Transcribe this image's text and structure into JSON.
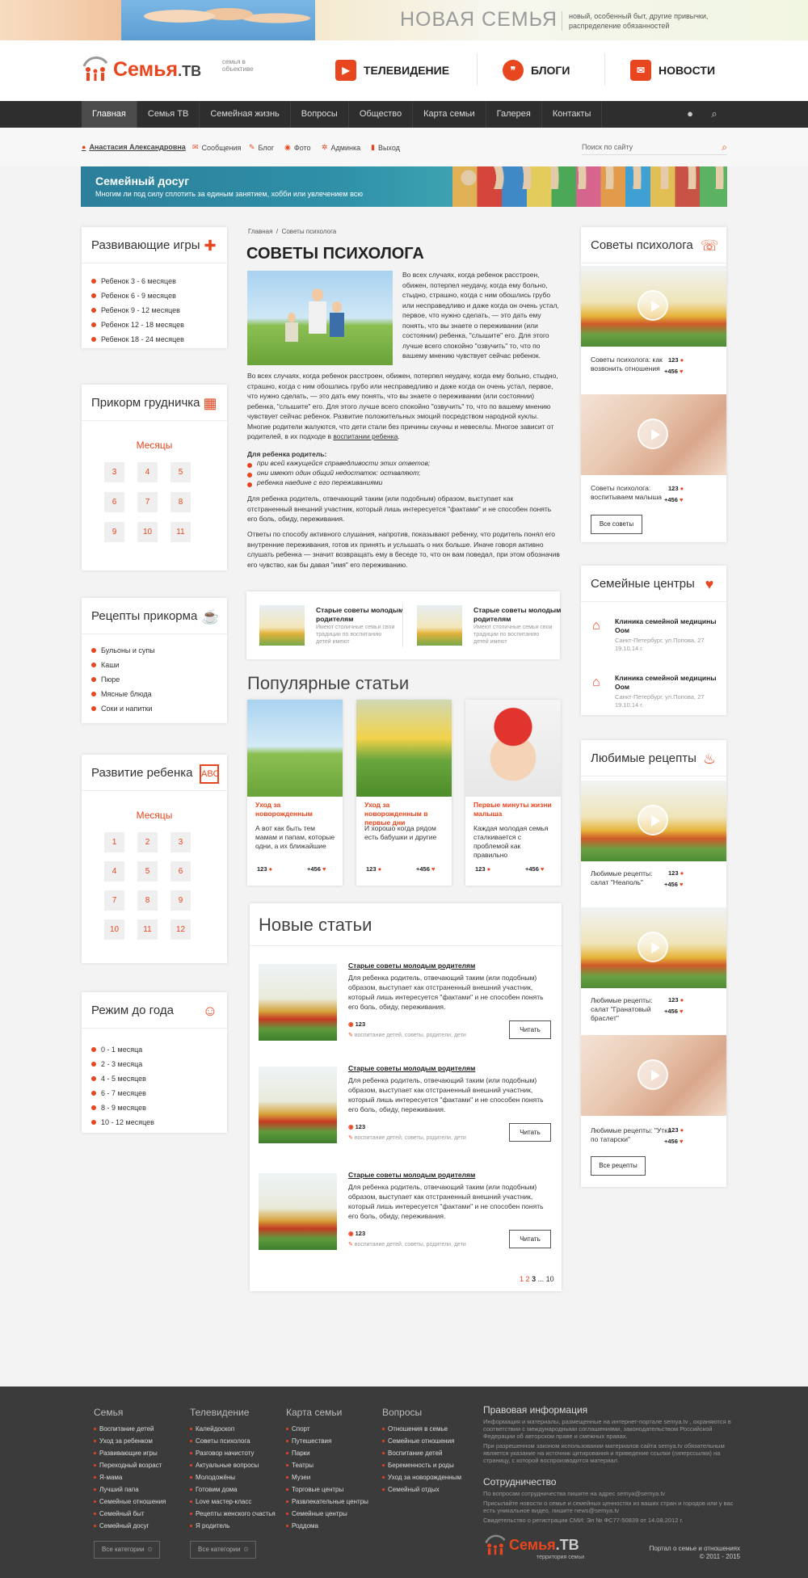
{
  "topbanner": {
    "slogan": "НОВАЯ СЕМЬЯ",
    "subtitle": "новый, особенный быт, другие привычки, распределение обязанностей"
  },
  "logo": {
    "name": "Семья",
    "suffix": ".ТВ",
    "tagline": "семья в объективе"
  },
  "header_nav": [
    {
      "label": "ТЕЛЕВИДЕНИЕ",
      "icon": "play-icon"
    },
    {
      "label": "БЛОГИ",
      "icon": "quote-icon"
    },
    {
      "label": "НОВОСТИ",
      "icon": "megaphone-icon"
    }
  ],
  "main_nav": [
    "Главная",
    "Семья ТВ",
    "Семейная жизнь",
    "Вопросы",
    "Общество",
    "Карта семьи",
    "Галерея",
    "Контакты"
  ],
  "user_bar": {
    "user": "Анастасия Александровна",
    "links": [
      "Сообщения",
      "Блог",
      "Фото",
      "Админка",
      "Выход"
    ],
    "search_placeholder": "Поиск по сайту"
  },
  "promo": {
    "title": "Семейный досуг",
    "text": "Многим ли под силу сплотить за единым занятием, хобби или увлечением всю"
  },
  "left": {
    "games": {
      "title": "Развивающие игры",
      "items": [
        "Ребенок 3 - 6 месяцев",
        "Ребенок 6 - 9 месяцев",
        "Ребенок 9 - 12 месяцев",
        "Ребенок 12 - 18 месяцев",
        "Ребенок 18 - 24 месяцев"
      ]
    },
    "feeding": {
      "title": "Прикорм грудничка",
      "months_label": "Месяцы",
      "months": [
        "3",
        "4",
        "5",
        "6",
        "7",
        "8",
        "9",
        "10",
        "11"
      ]
    },
    "recipes": {
      "title": "Рецепты прикорма",
      "items": [
        "Бульоны и супы",
        "Каши",
        "Пюре",
        "Мясные блюда",
        "Соки и напитки"
      ]
    },
    "development": {
      "title": "Развитие ребенка",
      "months_label": "Месяцы",
      "months": [
        "1",
        "2",
        "3",
        "4",
        "5",
        "6",
        "7",
        "8",
        "9",
        "10",
        "11",
        "12"
      ]
    },
    "regime": {
      "title": "Режим до года",
      "items": [
        "0 - 1 месяца",
        "2 - 3 месяца",
        "4 - 5 месяцев",
        "6 - 7 месяцев",
        "8 - 9 месяцев",
        "10 - 12 месяцев"
      ]
    }
  },
  "article": {
    "breadcrumb": [
      "Главная",
      "Советы психолога"
    ],
    "title": "СОВЕТЫ ПСИХОЛОГА",
    "p1": "Во всех случаях, когда ребенок расстроен, обижен, потерпел неудачу, когда ему больно, стыдно, страшно, когда с ним обошлись грубо или несправедливо и даже когда он очень устал, первое, что нужно сделать, — это дать ему понять, что вы знаете о переживании (или состоянии) ребенка, \"слышите\" его. Для этого лучше всего спокойно \"озвучить\" то, что по вашему мнению чувствует сейчас ребенок.",
    "p2_a": "Во всех случаях, когда ребенок расстроен, обижен, потерпел неудачу, когда ему больно, стыдно, страшно, когда с ним обошлись грубо или несправедливо и даже когда он очень устал, первое, что нужно сделать, — это дать ему понять, что вы знаете о переживании (или состоянии) ребенка, \"слышите\" его. Для этого лучше всего спокойно \"озвучить\" то, что по вашему мнению чувствует сейчас ребенок. Развитие положительных эмоций посредством народной куклы. Многие родители жалуются, что дети стали без причины скучны и невеселы. Многое зависит от родителей, в их подходе в ",
    "p2_link": "воспитании ребенка",
    "list_title": "Для  ребенка родитель:",
    "list": [
      "при всей кажущейся справедливости этих ответов;",
      "они имеют один общий недостаток: оставляют;",
      "ребенка наедине с его переживаниями"
    ],
    "p3": "Для ребенка родитель, отвечающий таким (или подобным) образом, выступает как отстраненный внешний участник, который лишь интересуется \"фактами\" и не способен понять его боль, обиду, переживания.",
    "p4": "Ответы по способу активного слушания, напротив, показывают ребенку, что родитель понял его внутренние переживания, готов их принять и услышать о них больше. Иначе говоря активно слушать ребенка — значит возвращать ему в беседе то, что он вам поведал, при этом обозначив его чувство, как бы давая \"имя\" его переживанию."
  },
  "related": [
    {
      "title": "Старые советы молодым родителям",
      "desc": "Имеют столичные семьи свои традиции по воспитанию детей имеют"
    },
    {
      "title": "Старые советы молодым родителям",
      "desc": "Имеют столичные семьи свои традиции по воспитанию детей имеют"
    }
  ],
  "popular": {
    "title": "Популярные статьи",
    "items": [
      {
        "title": "Уход за новорожденным",
        "desc": "А вот как быть тем мамам и папам, которые одни, а их ближайшие",
        "comments": "123",
        "likes": "+456"
      },
      {
        "title": "Уход за новорожденным в первые дни",
        "desc": "И хорошо когда рядом есть бабушки и другие",
        "comments": "123",
        "likes": "+456"
      },
      {
        "title": "Первые минуты жизни малыша",
        "desc": "Каждая молодая семья сталкивается с проблемой как правильно",
        "comments": "123",
        "likes": "+456"
      }
    ]
  },
  "new_articles": {
    "title": "Новые статьи",
    "items": [
      {
        "title": "Старые советы молодым родителям",
        "text": "Для ребенка родитель, отвечающий таким (или подобным) образом, выступает как отстраненный внешний участник, который лишь интересуется \"фактами\" и не способен понять его боль, обиду, переживания.",
        "views": "123",
        "tags": "воспитание детей, советы, родители, дети",
        "button": "Читать"
      },
      {
        "title": "Старые советы молодым родителям",
        "text": "Для ребенка родитель, отвечающий таким (или подобным) образом, выступает как отстраненный внешний участник, который лишь интересуется \"фактами\" и не способен понять его боль, обиду, переживания.",
        "views": "123",
        "tags": "воспитание детей, советы, родители, дети",
        "button": "Читать"
      },
      {
        "title": "Старые советы молодым родителям",
        "text": "Для ребенка родитель, отвечающий таким (или подобным) образом, выступает как отстраненный внешний участник, который лишь интересуется \"фактами\" и не способен понять его боль, обиду, переживания.",
        "views": "123",
        "tags": "воспитание детей, советы, родители, дети",
        "button": "Читать"
      }
    ],
    "pager": {
      "pages": [
        "1",
        "2",
        "3"
      ],
      "ellipsis": "...",
      "last": "10"
    }
  },
  "right": {
    "psych": {
      "title": "Советы психолога",
      "items": [
        {
          "caption": "Советы психолога: как возвонить отношения",
          "comments": "123",
          "likes": "+456"
        },
        {
          "caption": "Советы психолога: воспитываем малыша",
          "comments": "123",
          "likes": "+456"
        }
      ],
      "button": "Все советы"
    },
    "centers": {
      "title": "Семейные центры",
      "items": [
        {
          "name": "Клиника семейной медицины Оом",
          "address": "Санкт-Петербург, ул.Попова, 27 19.10.14 г."
        },
        {
          "name": "Клиника семейной медицины Оом",
          "address": "Санкт-Петербург, ул.Попова, 27 19.10.14 г."
        }
      ]
    },
    "recipes": {
      "title": "Любимые рецепты",
      "items": [
        {
          "caption": "Любимые рецепты: салат \"Неаполь\"",
          "comments": "123",
          "likes": "+456"
        },
        {
          "caption": "Любимые рецепты: салат \"Гранатовый браслет\"",
          "comments": "123",
          "likes": "+456"
        },
        {
          "caption": "Любимые рецепты: \"Утка по татарски\"",
          "comments": "123",
          "likes": "+456"
        }
      ],
      "button": "Все рецепты"
    }
  },
  "footer": {
    "cols": [
      {
        "title": "Семья",
        "items": [
          "Воспитание детей",
          "Уход за ребенком",
          "Развивающие игры",
          "Переходный возраст",
          "Я-мама",
          "Лучший папа",
          "Семейные отношения",
          "Семейный быт",
          "Семейный досуг"
        ],
        "button": "Все категории"
      },
      {
        "title": "Телевидение",
        "items": [
          "Калейдоскоп",
          "Советы психолога",
          "Разговор начистоту",
          "Актуальные вопросы",
          "Молодожёны",
          "Готовим дома",
          "Love мастер-класс",
          "Рецепты женского счастья",
          "Я родитель"
        ],
        "button": "Все категории"
      },
      {
        "title": "Карта семьи",
        "items": [
          "Спорт",
          "Путешествия",
          "Парки",
          "Театры",
          "Музеи",
          "Торговые центры",
          "Развлекательные центры",
          "Семейные центры",
          "Роддома"
        ]
      },
      {
        "title": "Вопросы",
        "items": [
          "Отношения в семье",
          "Семейные отношения",
          "Воспитание детей",
          "Беременность и роды",
          "Уход за новорожденным",
          "Семейный отдых"
        ]
      }
    ],
    "legal_title": "Правовая информация",
    "legal_p1": "Информация и материалы, размещенные на интернет-портале semya.tv , охраняются в соответствии с международными соглашениями, законодательством Российской Федерации об авторском праве и смежных правах.",
    "legal_p2": "При разрешенном законом использовании материалов сайта semya.tv обязательным является указание на источник цитирования и приведение ссылки (гиперссылки) на страницу, с которой воспроизводится материал.",
    "coop_title": "Сотрудничество",
    "coop_p1": "По вопросам сотрудничества пишите на адрес semya@semya.tv",
    "coop_p2": "Присылайте новости о семье и семейных ценностях из ваших стран и городов или у вас есть уникальное видео, пишите news@semya.tv",
    "coop_p3": "Свидетельство о регистрации СМИ: Эл № ФС77-50839 от 14.08.2012 г.",
    "logo_tag": "территория семьи",
    "portal": "Портал о семье и отношениях",
    "copy": "© 2011 - 2015"
  }
}
